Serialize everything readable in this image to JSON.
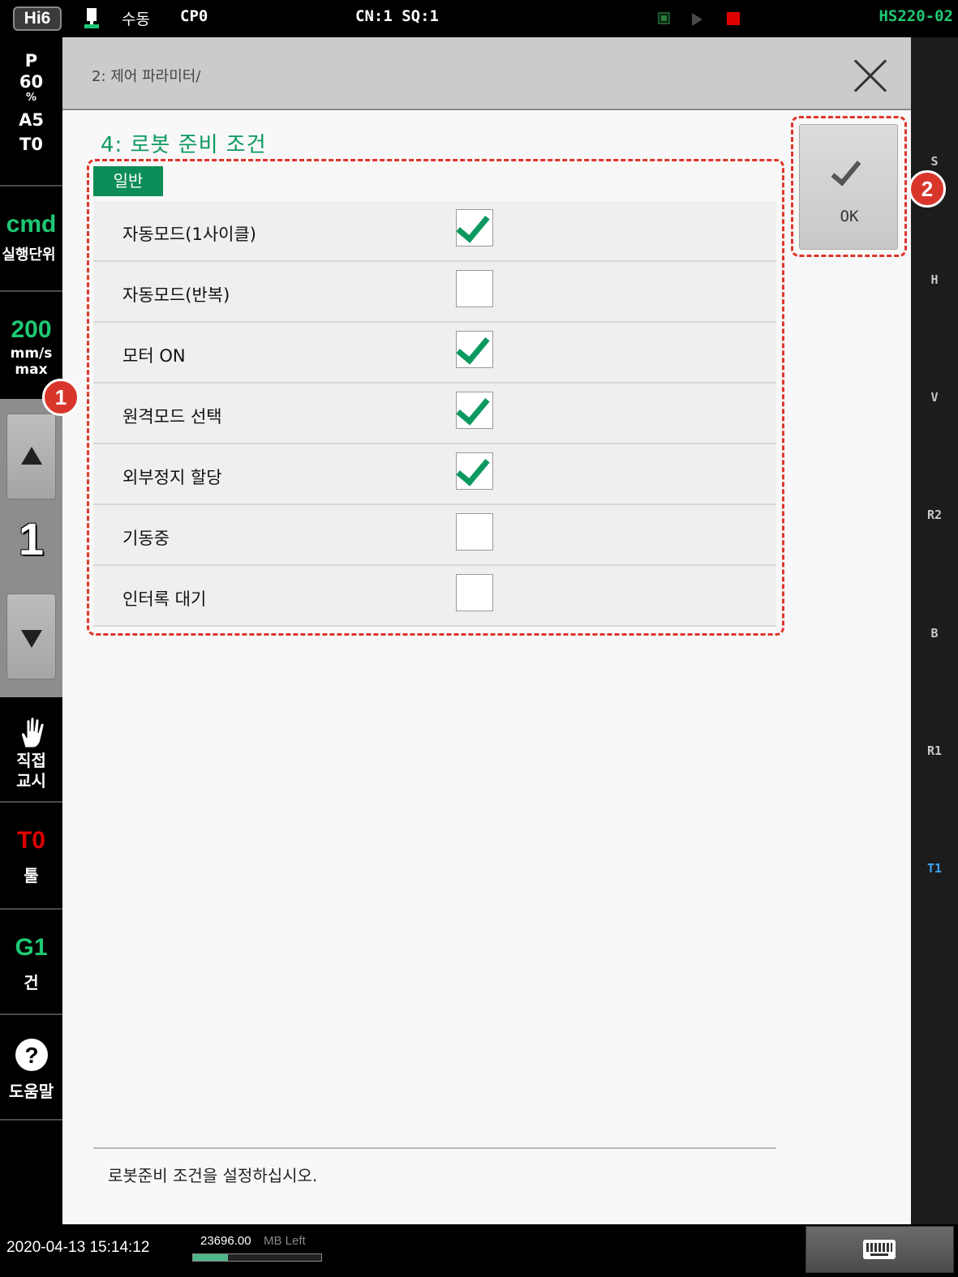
{
  "topbar": {
    "logo": "Hi6",
    "mode": "수동",
    "cp": "CP0",
    "cn_sq": "CN:1 SQ:1",
    "model": "HS220-02"
  },
  "left": {
    "p_label": "P",
    "p_value": "60",
    "p_unit": "%",
    "a_label": "A5",
    "t_label": "T0",
    "cmd": "cmd",
    "cmd_sub": "실행단위",
    "speed": "200",
    "speed_unit": "mm/s",
    "speed_sub": "max",
    "step": "1",
    "direct_teach": "직접\n교시",
    "tool_code": "T0",
    "tool_label": "툴",
    "gun_code": "G1",
    "gun_label": "건",
    "help_label": "도움말"
  },
  "badges": {
    "one": "1",
    "two": "2"
  },
  "main": {
    "breadcrumb": "2: 제어 파라미터/",
    "section_title": "4: 로봇 준비 조건",
    "group_tab": "일반",
    "items": [
      {
        "label": "자동모드(1사이클)",
        "checked": true
      },
      {
        "label": "자동모드(반복)",
        "checked": false
      },
      {
        "label": "모터 ON",
        "checked": true
      },
      {
        "label": "원격모드 선택",
        "checked": true
      },
      {
        "label": "외부정지 할당",
        "checked": true
      },
      {
        "label": "기동중",
        "checked": false
      },
      {
        "label": "인터록 대기",
        "checked": false
      }
    ],
    "ok_label": "OK",
    "message": "로봇준비 조건을 설정하십시오."
  },
  "axes": [
    "S",
    "H",
    "V",
    "R2",
    "B",
    "R1",
    "T1"
  ],
  "colors": {
    "accent_green": "#0c9960",
    "status_green": "#1ec873",
    "alert_red": "#e00000",
    "axis_active": "#3aa6ff"
  },
  "bottom": {
    "datetime": "2020-04-13 15:14:12",
    "memory": "23696.00",
    "memory_unit": "MB Left",
    "memory_used_fraction": 0.27
  }
}
